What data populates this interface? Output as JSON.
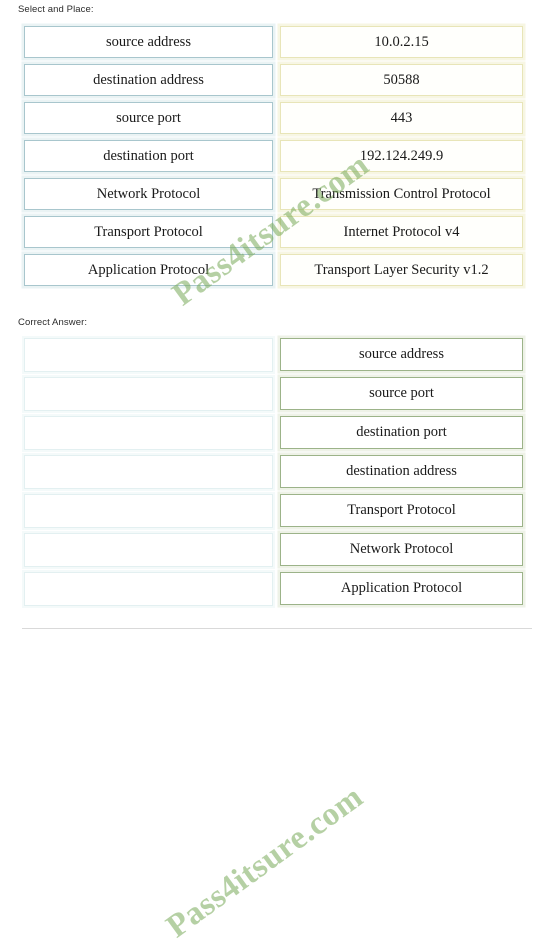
{
  "captions": {
    "select_and_place": "Select and Place:",
    "correct_answer": "Correct Answer:"
  },
  "watermark": {
    "text": "Pass4itsure.com"
  },
  "select_and_place": {
    "left_column": [
      "source address",
      "destination address",
      "source port",
      "destination port",
      "Network Protocol",
      "Transport Protocol",
      "Application Protocol"
    ],
    "right_column": [
      "10.0.2.15",
      "50588",
      "443",
      "192.124.249.9",
      "Transmission Control Protocol",
      "Internet Protocol v4",
      "Transport Layer Security v1.2"
    ]
  },
  "correct_answer": {
    "left_column": [
      "",
      "",
      "",
      "",
      "",
      "",
      ""
    ],
    "right_column": [
      "source address",
      "source port",
      "destination port",
      "destination address",
      "Transport Protocol",
      "Network Protocol",
      "Application Protocol"
    ]
  },
  "colors": {
    "teal_border": "#a8c6cd",
    "cream_border": "#e8e5b8",
    "green_border": "#9cb389",
    "empty_border": "#e3f0f1",
    "watermark_green": "#7aab5a",
    "text": "#1a1a1a"
  }
}
